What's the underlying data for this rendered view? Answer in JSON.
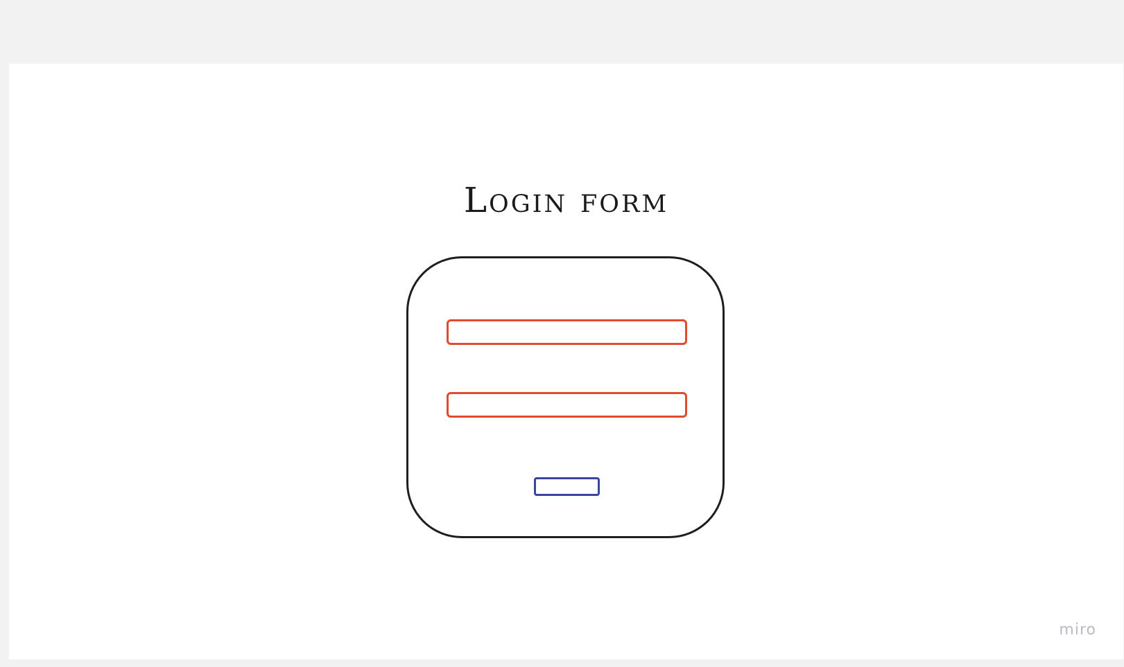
{
  "diagram": {
    "title": "Login form",
    "colors": {
      "frame": "#1e1e1e",
      "input_border": "#e04a2f",
      "button_border": "#3a45a0",
      "canvas": "#ffffff",
      "background": "#f2f2f2"
    },
    "fields": [
      {
        "value": ""
      },
      {
        "value": ""
      }
    ],
    "button": {
      "label": ""
    }
  },
  "watermark": {
    "text": "miro"
  }
}
